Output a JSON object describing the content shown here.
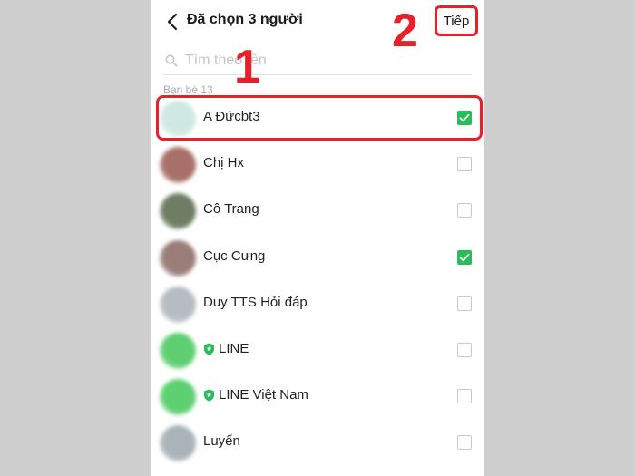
{
  "header": {
    "title": "Đã chọn 3 người",
    "next_label": "Tiếp"
  },
  "search": {
    "placeholder": "Tìm theo tên"
  },
  "section_label": "Bạn bè 13",
  "contacts": [
    {
      "name": "A Đứcbt3",
      "checked": true,
      "official": false,
      "avatar_color": "#cfe9e2"
    },
    {
      "name": "Chị Hx",
      "checked": false,
      "official": false,
      "avatar_color": "#a8706a"
    },
    {
      "name": "Cô Trang",
      "checked": false,
      "official": false,
      "avatar_color": "#6e7d64"
    },
    {
      "name": "Cục Cưng",
      "checked": true,
      "official": false,
      "avatar_color": "#9b7d78"
    },
    {
      "name": "Duy TTS Hỏi đáp",
      "checked": false,
      "official": false,
      "avatar_color": "#b6bcc2"
    },
    {
      "name": "LINE",
      "checked": false,
      "official": true,
      "avatar_color": "#5ed071"
    },
    {
      "name": "LINE Việt Nam",
      "checked": false,
      "official": true,
      "avatar_color": "#5ed071"
    },
    {
      "name": "Luyến",
      "checked": false,
      "official": false,
      "avatar_color": "#a9b3b8"
    }
  ],
  "annotations": {
    "step1": "1",
    "step2": "2"
  },
  "colors": {
    "accent_green": "#2bbb5b",
    "annotation_red": "#e8202a"
  }
}
